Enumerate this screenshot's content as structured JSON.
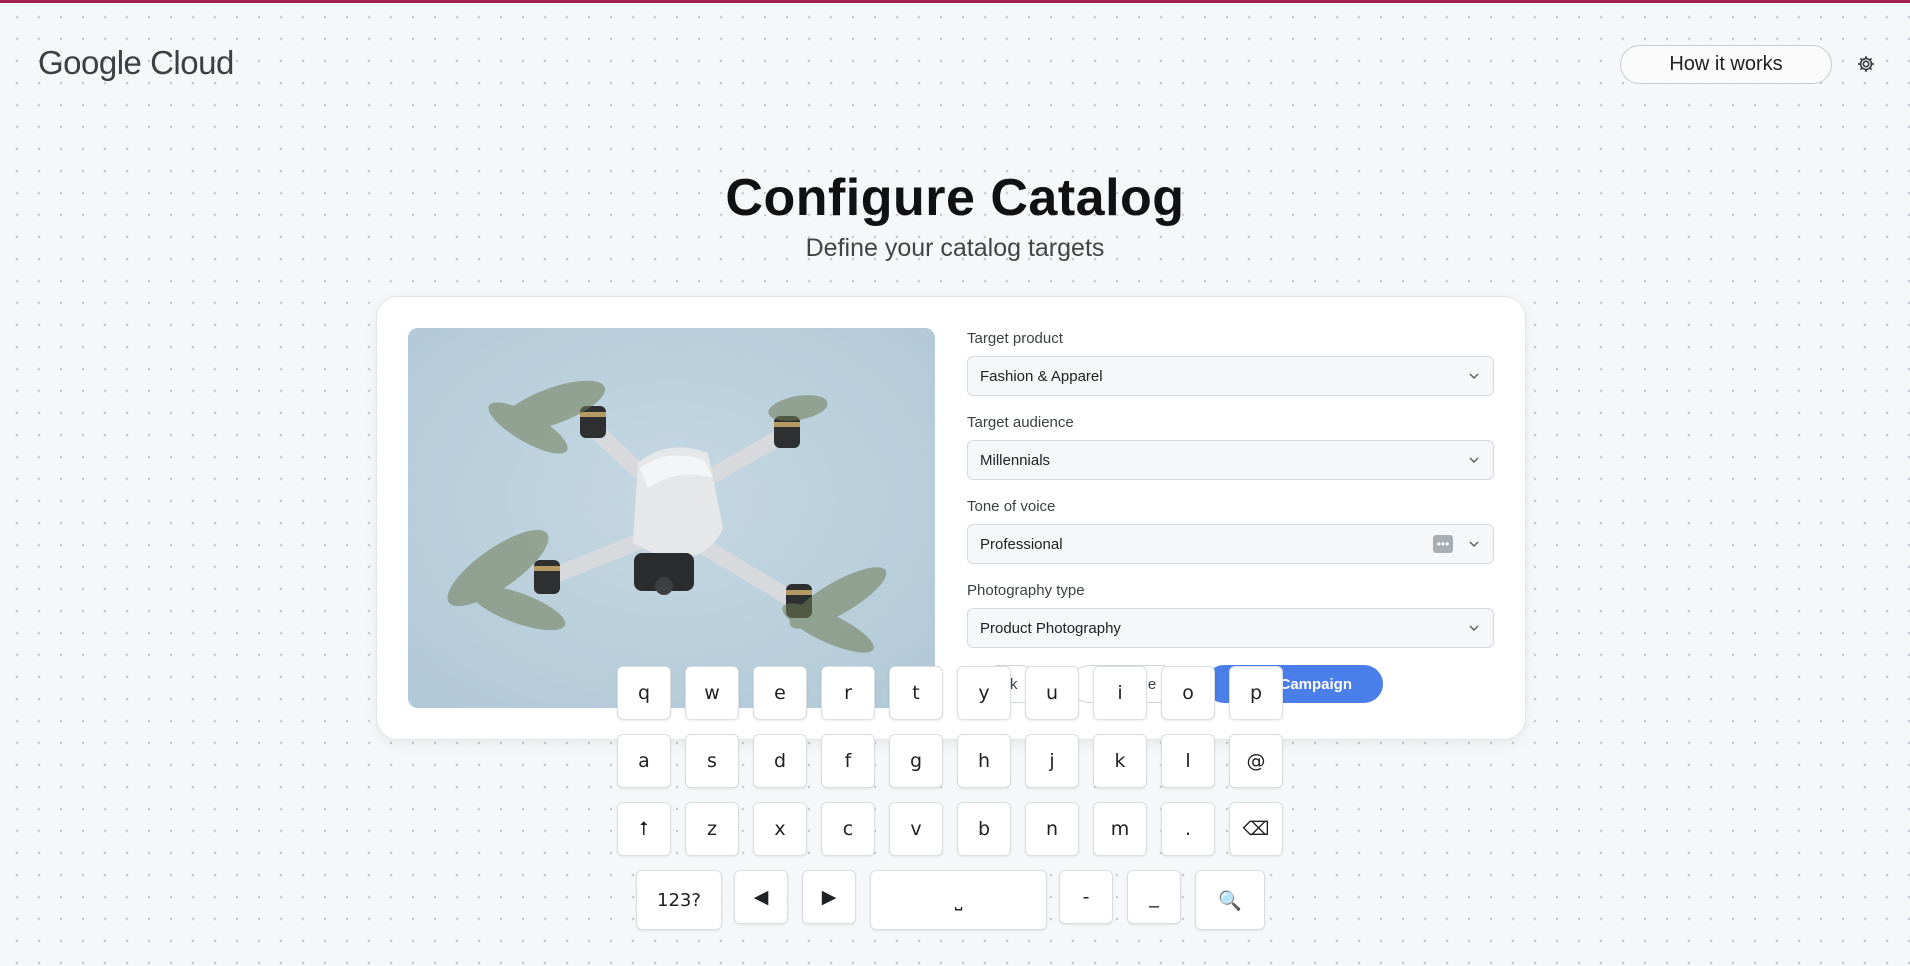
{
  "header": {
    "logo_text": "Google Cloud",
    "how_it_works_label": "How it works",
    "accent_color": "#a3204b"
  },
  "page": {
    "title": "Configure Catalog",
    "subtitle": "Define your catalog targets"
  },
  "form": {
    "fields": [
      {
        "label": "Target product",
        "value": "Fashion & Apparel"
      },
      {
        "label": "Target audience",
        "value": "Millennials"
      },
      {
        "label": "Tone of voice",
        "value": "Professional"
      },
      {
        "label": "Photography type",
        "value": "Product Photography"
      }
    ],
    "tone_more_icon": "ellipsis-icon",
    "back_label": "ck",
    "middle_label": "F         ze",
    "primary_label": "Campaign",
    "primary_color": "#4a7ee8"
  },
  "image": {
    "subject": "drone-icon"
  },
  "keyboard": {
    "row1": [
      "q",
      "w",
      "e",
      "r",
      "t",
      "y",
      "u",
      "i",
      "o",
      "p"
    ],
    "row2": [
      "a",
      "s",
      "d",
      "f",
      "g",
      "h",
      "j",
      "k",
      "l",
      "@"
    ],
    "row3": [
      "⭡",
      "z",
      "x",
      "c",
      "v",
      "b",
      "n",
      "m",
      ".",
      "⌫"
    ],
    "row4": [
      "123?",
      "◀",
      "▶",
      "⎵",
      "-",
      "_",
      "🔍"
    ]
  }
}
